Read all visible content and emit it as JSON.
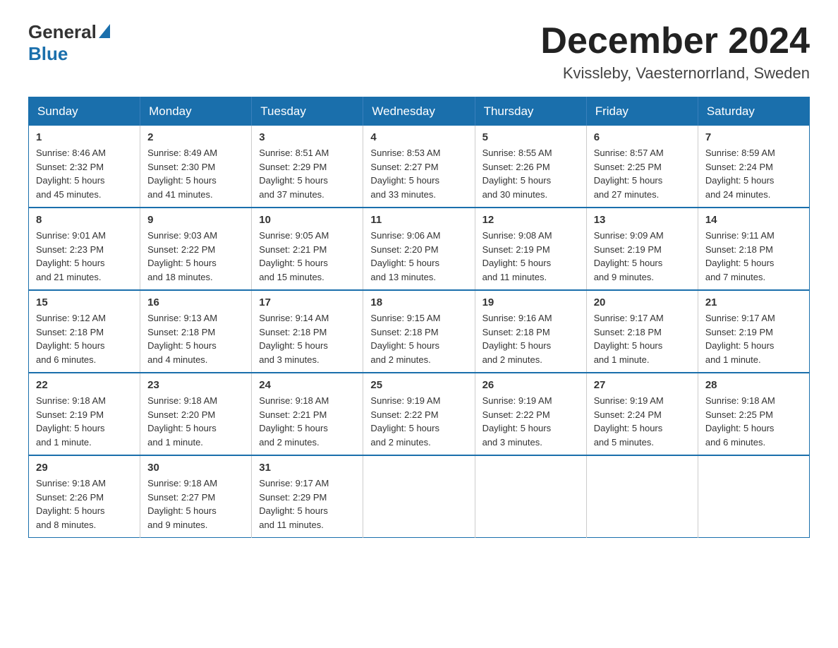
{
  "logo": {
    "general": "General",
    "blue": "Blue"
  },
  "header": {
    "month": "December 2024",
    "location": "Kvissleby, Vaesternorrland, Sweden"
  },
  "weekdays": [
    "Sunday",
    "Monday",
    "Tuesday",
    "Wednesday",
    "Thursday",
    "Friday",
    "Saturday"
  ],
  "weeks": [
    [
      {
        "day": "1",
        "info": "Sunrise: 8:46 AM\nSunset: 2:32 PM\nDaylight: 5 hours\nand 45 minutes."
      },
      {
        "day": "2",
        "info": "Sunrise: 8:49 AM\nSunset: 2:30 PM\nDaylight: 5 hours\nand 41 minutes."
      },
      {
        "day": "3",
        "info": "Sunrise: 8:51 AM\nSunset: 2:29 PM\nDaylight: 5 hours\nand 37 minutes."
      },
      {
        "day": "4",
        "info": "Sunrise: 8:53 AM\nSunset: 2:27 PM\nDaylight: 5 hours\nand 33 minutes."
      },
      {
        "day": "5",
        "info": "Sunrise: 8:55 AM\nSunset: 2:26 PM\nDaylight: 5 hours\nand 30 minutes."
      },
      {
        "day": "6",
        "info": "Sunrise: 8:57 AM\nSunset: 2:25 PM\nDaylight: 5 hours\nand 27 minutes."
      },
      {
        "day": "7",
        "info": "Sunrise: 8:59 AM\nSunset: 2:24 PM\nDaylight: 5 hours\nand 24 minutes."
      }
    ],
    [
      {
        "day": "8",
        "info": "Sunrise: 9:01 AM\nSunset: 2:23 PM\nDaylight: 5 hours\nand 21 minutes."
      },
      {
        "day": "9",
        "info": "Sunrise: 9:03 AM\nSunset: 2:22 PM\nDaylight: 5 hours\nand 18 minutes."
      },
      {
        "day": "10",
        "info": "Sunrise: 9:05 AM\nSunset: 2:21 PM\nDaylight: 5 hours\nand 15 minutes."
      },
      {
        "day": "11",
        "info": "Sunrise: 9:06 AM\nSunset: 2:20 PM\nDaylight: 5 hours\nand 13 minutes."
      },
      {
        "day": "12",
        "info": "Sunrise: 9:08 AM\nSunset: 2:19 PM\nDaylight: 5 hours\nand 11 minutes."
      },
      {
        "day": "13",
        "info": "Sunrise: 9:09 AM\nSunset: 2:19 PM\nDaylight: 5 hours\nand 9 minutes."
      },
      {
        "day": "14",
        "info": "Sunrise: 9:11 AM\nSunset: 2:18 PM\nDaylight: 5 hours\nand 7 minutes."
      }
    ],
    [
      {
        "day": "15",
        "info": "Sunrise: 9:12 AM\nSunset: 2:18 PM\nDaylight: 5 hours\nand 6 minutes."
      },
      {
        "day": "16",
        "info": "Sunrise: 9:13 AM\nSunset: 2:18 PM\nDaylight: 5 hours\nand 4 minutes."
      },
      {
        "day": "17",
        "info": "Sunrise: 9:14 AM\nSunset: 2:18 PM\nDaylight: 5 hours\nand 3 minutes."
      },
      {
        "day": "18",
        "info": "Sunrise: 9:15 AM\nSunset: 2:18 PM\nDaylight: 5 hours\nand 2 minutes."
      },
      {
        "day": "19",
        "info": "Sunrise: 9:16 AM\nSunset: 2:18 PM\nDaylight: 5 hours\nand 2 minutes."
      },
      {
        "day": "20",
        "info": "Sunrise: 9:17 AM\nSunset: 2:18 PM\nDaylight: 5 hours\nand 1 minute."
      },
      {
        "day": "21",
        "info": "Sunrise: 9:17 AM\nSunset: 2:19 PM\nDaylight: 5 hours\nand 1 minute."
      }
    ],
    [
      {
        "day": "22",
        "info": "Sunrise: 9:18 AM\nSunset: 2:19 PM\nDaylight: 5 hours\nand 1 minute."
      },
      {
        "day": "23",
        "info": "Sunrise: 9:18 AM\nSunset: 2:20 PM\nDaylight: 5 hours\nand 1 minute."
      },
      {
        "day": "24",
        "info": "Sunrise: 9:18 AM\nSunset: 2:21 PM\nDaylight: 5 hours\nand 2 minutes."
      },
      {
        "day": "25",
        "info": "Sunrise: 9:19 AM\nSunset: 2:22 PM\nDaylight: 5 hours\nand 2 minutes."
      },
      {
        "day": "26",
        "info": "Sunrise: 9:19 AM\nSunset: 2:22 PM\nDaylight: 5 hours\nand 3 minutes."
      },
      {
        "day": "27",
        "info": "Sunrise: 9:19 AM\nSunset: 2:24 PM\nDaylight: 5 hours\nand 5 minutes."
      },
      {
        "day": "28",
        "info": "Sunrise: 9:18 AM\nSunset: 2:25 PM\nDaylight: 5 hours\nand 6 minutes."
      }
    ],
    [
      {
        "day": "29",
        "info": "Sunrise: 9:18 AM\nSunset: 2:26 PM\nDaylight: 5 hours\nand 8 minutes."
      },
      {
        "day": "30",
        "info": "Sunrise: 9:18 AM\nSunset: 2:27 PM\nDaylight: 5 hours\nand 9 minutes."
      },
      {
        "day": "31",
        "info": "Sunrise: 9:17 AM\nSunset: 2:29 PM\nDaylight: 5 hours\nand 11 minutes."
      },
      {
        "day": "",
        "info": ""
      },
      {
        "day": "",
        "info": ""
      },
      {
        "day": "",
        "info": ""
      },
      {
        "day": "",
        "info": ""
      }
    ]
  ]
}
